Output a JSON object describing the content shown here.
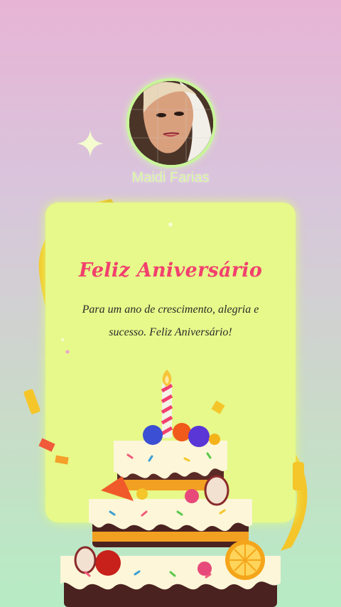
{
  "profile": {
    "name": "Maidi Farias",
    "avatar_icon": "profile-photo"
  },
  "card": {
    "title": "Feliz Aniversário",
    "message": "Para um ano de crescimento, alegria e sucesso. Feliz Aniversário!"
  },
  "colors": {
    "card_background": "#e6f98a",
    "title": "#f2406e",
    "name": "#d9f7a4",
    "ribbon": "#f7d12a"
  },
  "decorations": [
    "sparkle-icon",
    "ribbon",
    "confetti",
    "birthday-cake-illustration"
  ]
}
